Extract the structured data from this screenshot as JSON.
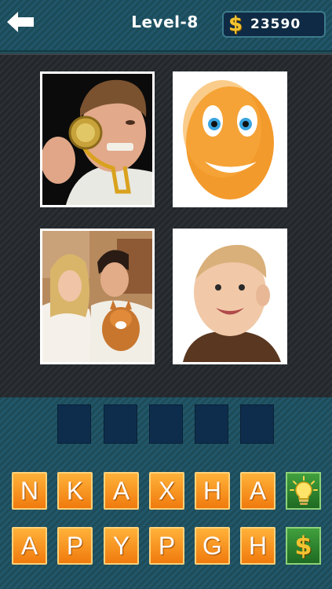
{
  "header": {
    "level_title": "Level-8",
    "coins": "23590",
    "currency_symbol": "$"
  },
  "pictures": [
    {
      "name": "man-with-medal-photo"
    },
    {
      "name": "smiley-face-photo"
    },
    {
      "name": "couple-with-dog-photo"
    },
    {
      "name": "baby-photo"
    }
  ],
  "answer": {
    "slot_count": 5
  },
  "letters": {
    "row1": [
      "N",
      "K",
      "A",
      "X",
      "H",
      "A"
    ],
    "row2": [
      "A",
      "P",
      "Y",
      "P",
      "G",
      "H"
    ]
  },
  "help_buttons": {
    "hint_icon": "lightbulb-icon",
    "buy_symbol": "$"
  },
  "colors": {
    "tile_orange": "#f59520",
    "slot_navy": "#0e2d4d",
    "help_green": "#2f8a30",
    "coin_gold": "#f2c230"
  }
}
